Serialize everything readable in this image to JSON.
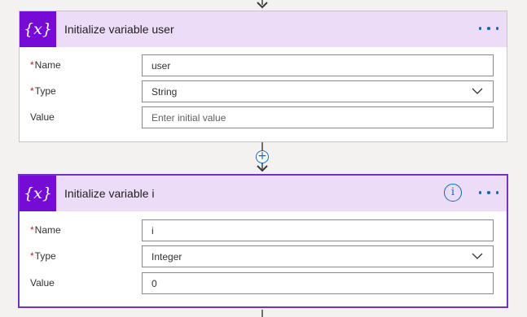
{
  "cards": [
    {
      "icon_glyph": "{x}",
      "title": "Initialize variable user",
      "fields": {
        "name": {
          "label": "Name",
          "required": "*",
          "value": "user"
        },
        "type": {
          "label": "Type",
          "required": "*",
          "value": "String"
        },
        "value": {
          "label": "Value",
          "placeholder": "Enter initial value"
        }
      }
    },
    {
      "icon_glyph": "{x}",
      "title": "Initialize variable i",
      "info_glyph": "i",
      "fields": {
        "name": {
          "label": "Name",
          "required": "*",
          "value": "i"
        },
        "type": {
          "label": "Type",
          "required": "*",
          "value": "Integer"
        },
        "value": {
          "label": "Value",
          "value": "0"
        }
      }
    }
  ],
  "insert_step_glyph": "+",
  "colors": {
    "icon_bg": "#770bd6",
    "header_bg": "#ecdcf7",
    "selected_border": "#7a2fbe",
    "accent_blue": "#0f6cbd",
    "required": "#a4262c"
  },
  "icons": {
    "variable": "variable-icon",
    "more": "more-options-icon",
    "info": "info-icon",
    "dropdown": "chevron-down-icon",
    "insert": "add-step-icon",
    "connector": "arrow-down-icon"
  }
}
